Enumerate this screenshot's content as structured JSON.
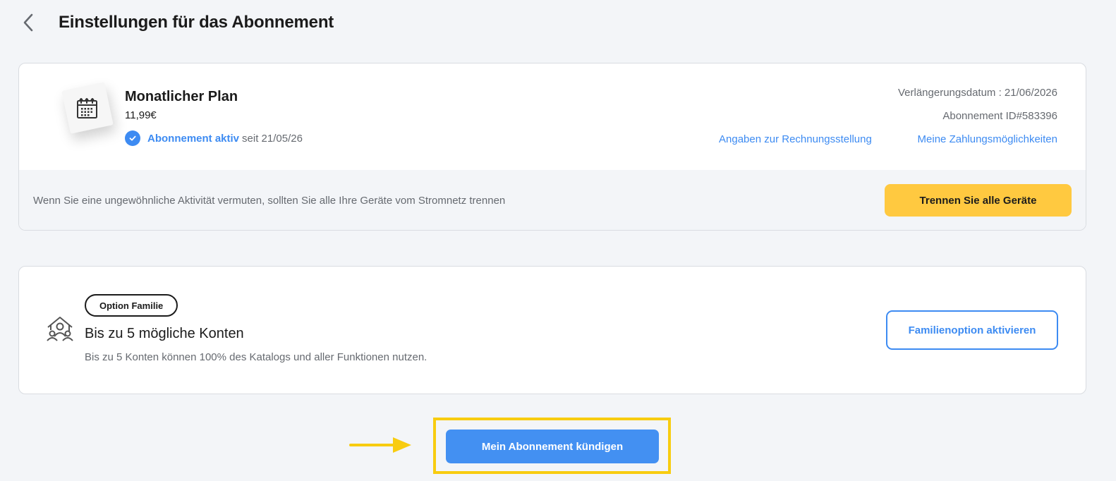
{
  "header": {
    "title": "Einstellungen für das Abonnement",
    "back_icon": "chevron-left-icon"
  },
  "plan": {
    "icon": "calendar-icon",
    "name": "Monatlicher Plan",
    "price": "11,99€",
    "status_active": "Abonnement aktiv",
    "status_since": "seit 21/05/26",
    "renewal": "Verlängerungsdatum : 21/06/2026",
    "subscription_id": "Abonnement ID#583396",
    "billing_link": "Angaben zur Rechnungsstellung",
    "payment_link": "Meine Zahlungsmöglichkeiten",
    "footer_text": "Wenn Sie eine ungewöhnliche Aktivität vermuten, sollten Sie alle Ihre Geräte vom Stromnetz trennen",
    "disconnect_label": "Trennen Sie alle Geräte"
  },
  "family": {
    "icon": "family-house-icon",
    "badge": "Option Familie",
    "title": "Bis zu 5 mögliche Konten",
    "description": "Bis zu 5 Konten können 100% des Katalogs und aller Funktionen nutzen.",
    "button_label": "Familienoption aktivieren"
  },
  "cancel": {
    "button_label": "Mein Abonnement kündigen"
  },
  "colors": {
    "accent_blue": "#3d8bf2",
    "warning_yellow": "#ffc940",
    "highlight_yellow": "#f8cc10",
    "background": "#f3f5f8"
  }
}
